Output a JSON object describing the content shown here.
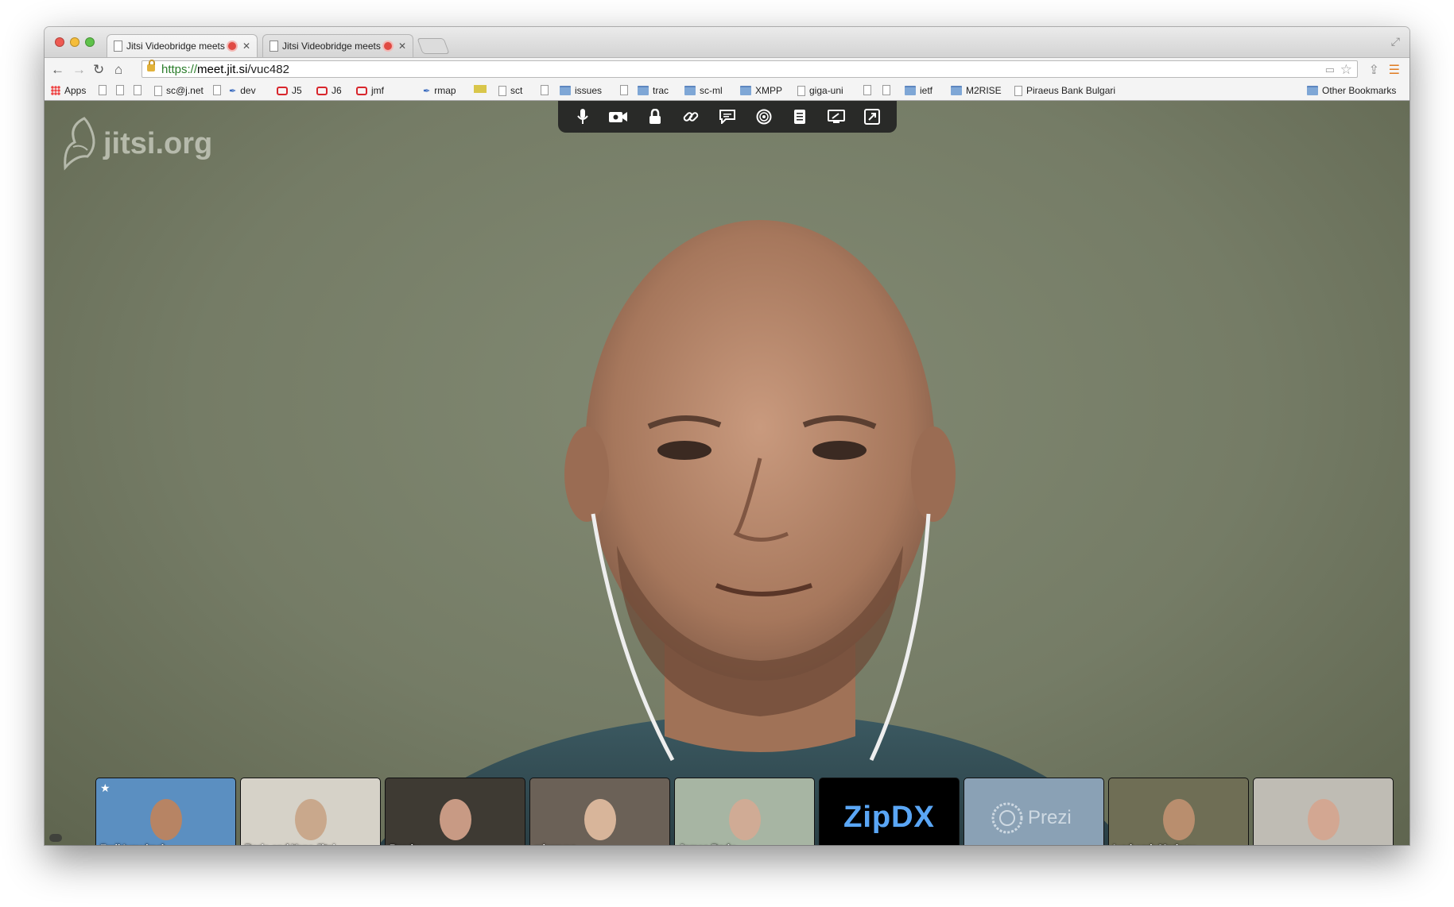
{
  "browser": {
    "tabs": [
      {
        "title": "Jitsi Videobridge meets",
        "recording": true
      },
      {
        "title": "Jitsi Videobridge meets",
        "recording": true
      }
    ],
    "url": {
      "scheme": "https://",
      "host": "meet.jit.si",
      "path": "/vuc482"
    },
    "bookmarks": [
      {
        "label": "Apps",
        "icon": "apps-grid-icon"
      },
      {
        "label": "",
        "icon": "page-icon"
      },
      {
        "label": "",
        "icon": "page-icon"
      },
      {
        "label": "",
        "icon": "page-icon"
      },
      {
        "label": "sc@j.net",
        "icon": "page-icon"
      },
      {
        "label": "",
        "icon": "page-icon"
      },
      {
        "label": "dev",
        "icon": "pin-icon"
      },
      {
        "label": "J5",
        "icon": "oracle-icon"
      },
      {
        "label": "J6",
        "icon": "oracle-icon"
      },
      {
        "label": "jmf",
        "icon": "oracle-icon"
      },
      {
        "label": "rmap",
        "icon": "pin-icon"
      },
      {
        "label": "",
        "icon": "image-icon"
      },
      {
        "label": "sct",
        "icon": "page-icon"
      },
      {
        "label": "",
        "icon": "page-icon"
      },
      {
        "label": "issues",
        "icon": "folder-icon"
      },
      {
        "label": "",
        "icon": "page-icon"
      },
      {
        "label": "trac",
        "icon": "folder-icon"
      },
      {
        "label": "sc-ml",
        "icon": "folder-icon"
      },
      {
        "label": "XMPP",
        "icon": "folder-icon"
      },
      {
        "label": "giga-uni",
        "icon": "page-icon"
      },
      {
        "label": "",
        "icon": "page-icon"
      },
      {
        "label": "",
        "icon": "page-icon"
      },
      {
        "label": "ietf",
        "icon": "folder-icon"
      },
      {
        "label": "M2RISE",
        "icon": "folder-icon"
      },
      {
        "label": "Piraeus Bank Bulgari",
        "icon": "page-icon"
      }
    ],
    "other_bookmarks": "Other Bookmarks"
  },
  "meeting": {
    "logo": "jitsi.org",
    "toolbar_icons": [
      "microphone-icon",
      "camera-icon",
      "lock-icon",
      "link-icon",
      "chat-icon",
      "record-icon",
      "document-icon",
      "desktop-share-icon",
      "fullscreen-icon"
    ],
    "participants": [
      {
        "name": "Emil Ivov (me)",
        "bg": "#5b8fc1",
        "skin": "#b78464",
        "moderator_star": true,
        "editable": true
      },
      {
        "name": "Boris and Yana Jitsi",
        "bg": "#d6d2c8",
        "skin": "#c9a88c"
      },
      {
        "name": "Randy",
        "bg": "#3e3a33",
        "skin": "#c89a84"
      },
      {
        "name": "mjgraves",
        "bg": "#6b6157",
        "skin": "#d8b59a"
      },
      {
        "name": "James Body",
        "bg": "#a7b5a3",
        "skin": "#d0ab95"
      },
      {
        "name": "",
        "type": "zipdx",
        "logo_text": "ZipDX"
      },
      {
        "name": "",
        "type": "prezi",
        "logo_text": "Prezi"
      },
      {
        "name": "Lyubomir Marinov",
        "bg": "#6f6e55",
        "skin": "#b98e6e"
      },
      {
        "name": "",
        "bg": "#bfbcb4",
        "skin": "#d3a792"
      }
    ]
  },
  "colors": {
    "background": "#757c66",
    "toolbar": "#232323"
  }
}
